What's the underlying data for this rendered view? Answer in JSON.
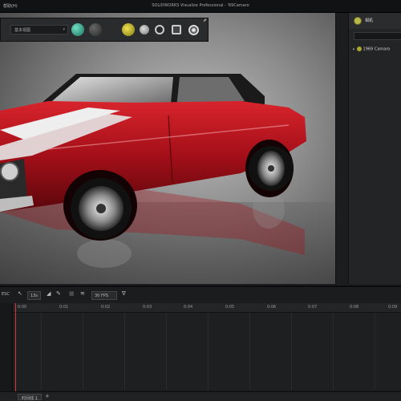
{
  "titlebar": {
    "menu": "帮助(H)",
    "title": "SOLIDWORKS Visualize Professional - '69Camaro"
  },
  "viewport_toolbar": {
    "camera_select": "基本视图",
    "icons": [
      "teal-sphere-icon",
      "dark-sphere-icon",
      "texture-icon",
      "light-icon",
      "rotate-icon",
      "screenshot-icon",
      "render-icon"
    ]
  },
  "right_panel": {
    "header_label": "相机",
    "tree_item": "1969 Camaro"
  },
  "timeline": {
    "toolbar": {
      "lock_label": "ESC",
      "fps_box": "13s",
      "speed_box": "30 FPS"
    },
    "ruler_ticks": [
      "0:00",
      "0:01",
      "0:02",
      "0:03",
      "0:04",
      "0:05",
      "0:06",
      "0:07",
      "0:08",
      "0:09"
    ],
    "tab_label": "时间线 1"
  },
  "colors": {
    "car_red": "#b3111b",
    "stripe": "#eeeeee",
    "playhead": "#d23a3a",
    "accent_yellow": "#b7b84a"
  }
}
